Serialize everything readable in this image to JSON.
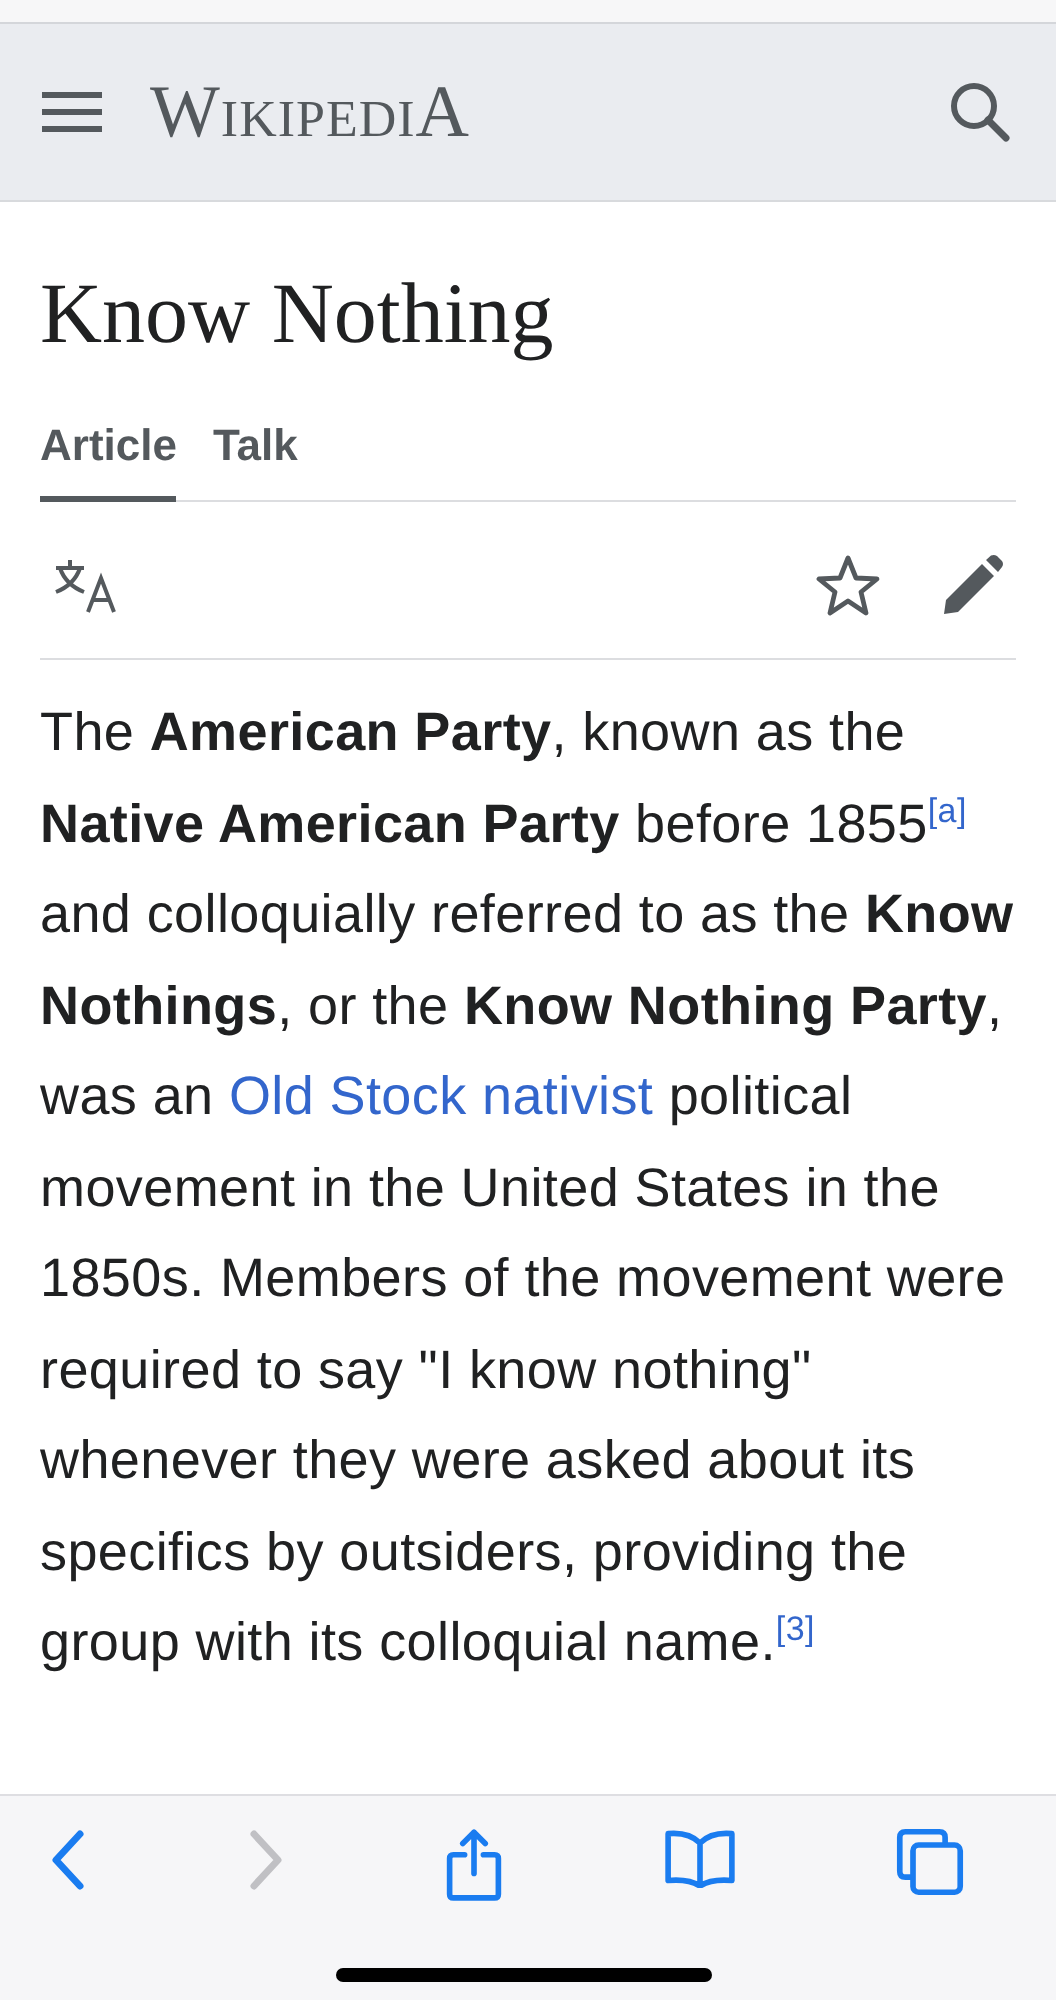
{
  "header": {
    "logo": "WikipediA"
  },
  "article": {
    "title": "Know Nothing",
    "tabs": [
      {
        "label": "Article",
        "selected": true
      },
      {
        "label": "Talk",
        "selected": false
      }
    ],
    "paragraph": [
      {
        "kind": "text",
        "text": "The **American Party**, known as the **Native American Party** before 1855"
      },
      {
        "kind": "ref",
        "text": "[a]"
      },
      {
        "kind": "text",
        "text": " and colloquially referred to as the **Know Nothings**, or the **Know Nothing Party**, was an "
      },
      {
        "kind": "link",
        "text": "Old Stock nativist"
      },
      {
        "kind": "text",
        "text": " political movement in the United States in the 1850s. Members of the movement were required to say \"I know nothing\" whenever they were asked about its specifics by outsiders, providing the group with its colloquial name."
      },
      {
        "kind": "ref",
        "text": "[3]"
      }
    ]
  },
  "toolbar": {
    "back": {
      "disabled": false
    },
    "forward": {
      "disabled": true
    }
  }
}
